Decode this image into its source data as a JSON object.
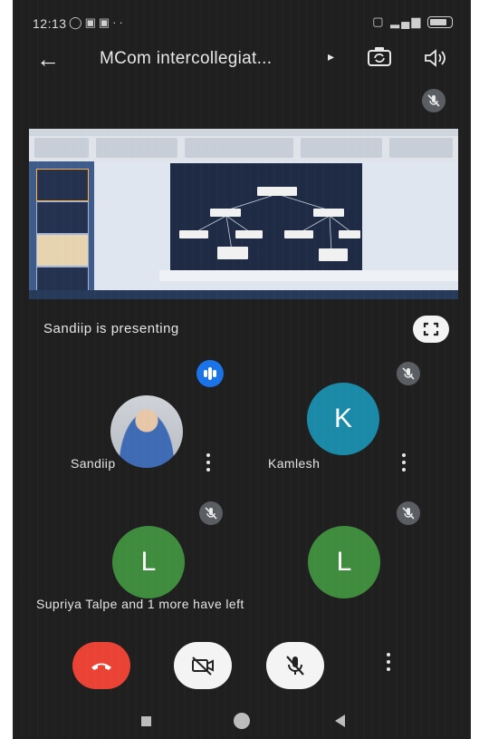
{
  "status_bar": {
    "time": "12:13",
    "left_icons": [
      "message-icon",
      "photo-icon",
      "photo-icon",
      "more-icon"
    ],
    "right_icons": [
      "sim-icon",
      "signal-icon",
      "battery-icon"
    ]
  },
  "top_bar": {
    "meeting_title": "MCom intercollegiat...",
    "icons": [
      "back-arrow-icon",
      "switch-camera-icon",
      "speaker-icon"
    ]
  },
  "presentation": {
    "status_text": "Sandiip is presenting"
  },
  "participants": [
    {
      "name": "Sandiip",
      "avatar": "photo",
      "speaking": true
    },
    {
      "name": "Kamlesh",
      "avatar_letter": "K",
      "muted": true
    },
    {
      "avatar_letter": "L",
      "muted": true
    },
    {
      "avatar_letter": "L",
      "muted": true
    }
  ],
  "notification": "Supriya Talpe and 1 more have left",
  "controls": {
    "icons": [
      "end-call-icon",
      "camera-off-icon",
      "mic-off-icon",
      "more-vert-icon"
    ]
  },
  "colors": {
    "background": "#1f1f1f",
    "end_call": "#ea4335",
    "speaking": "#1a73e8",
    "avatar_k": "#1a8aa8",
    "avatar_l": "#3f8c3e"
  }
}
